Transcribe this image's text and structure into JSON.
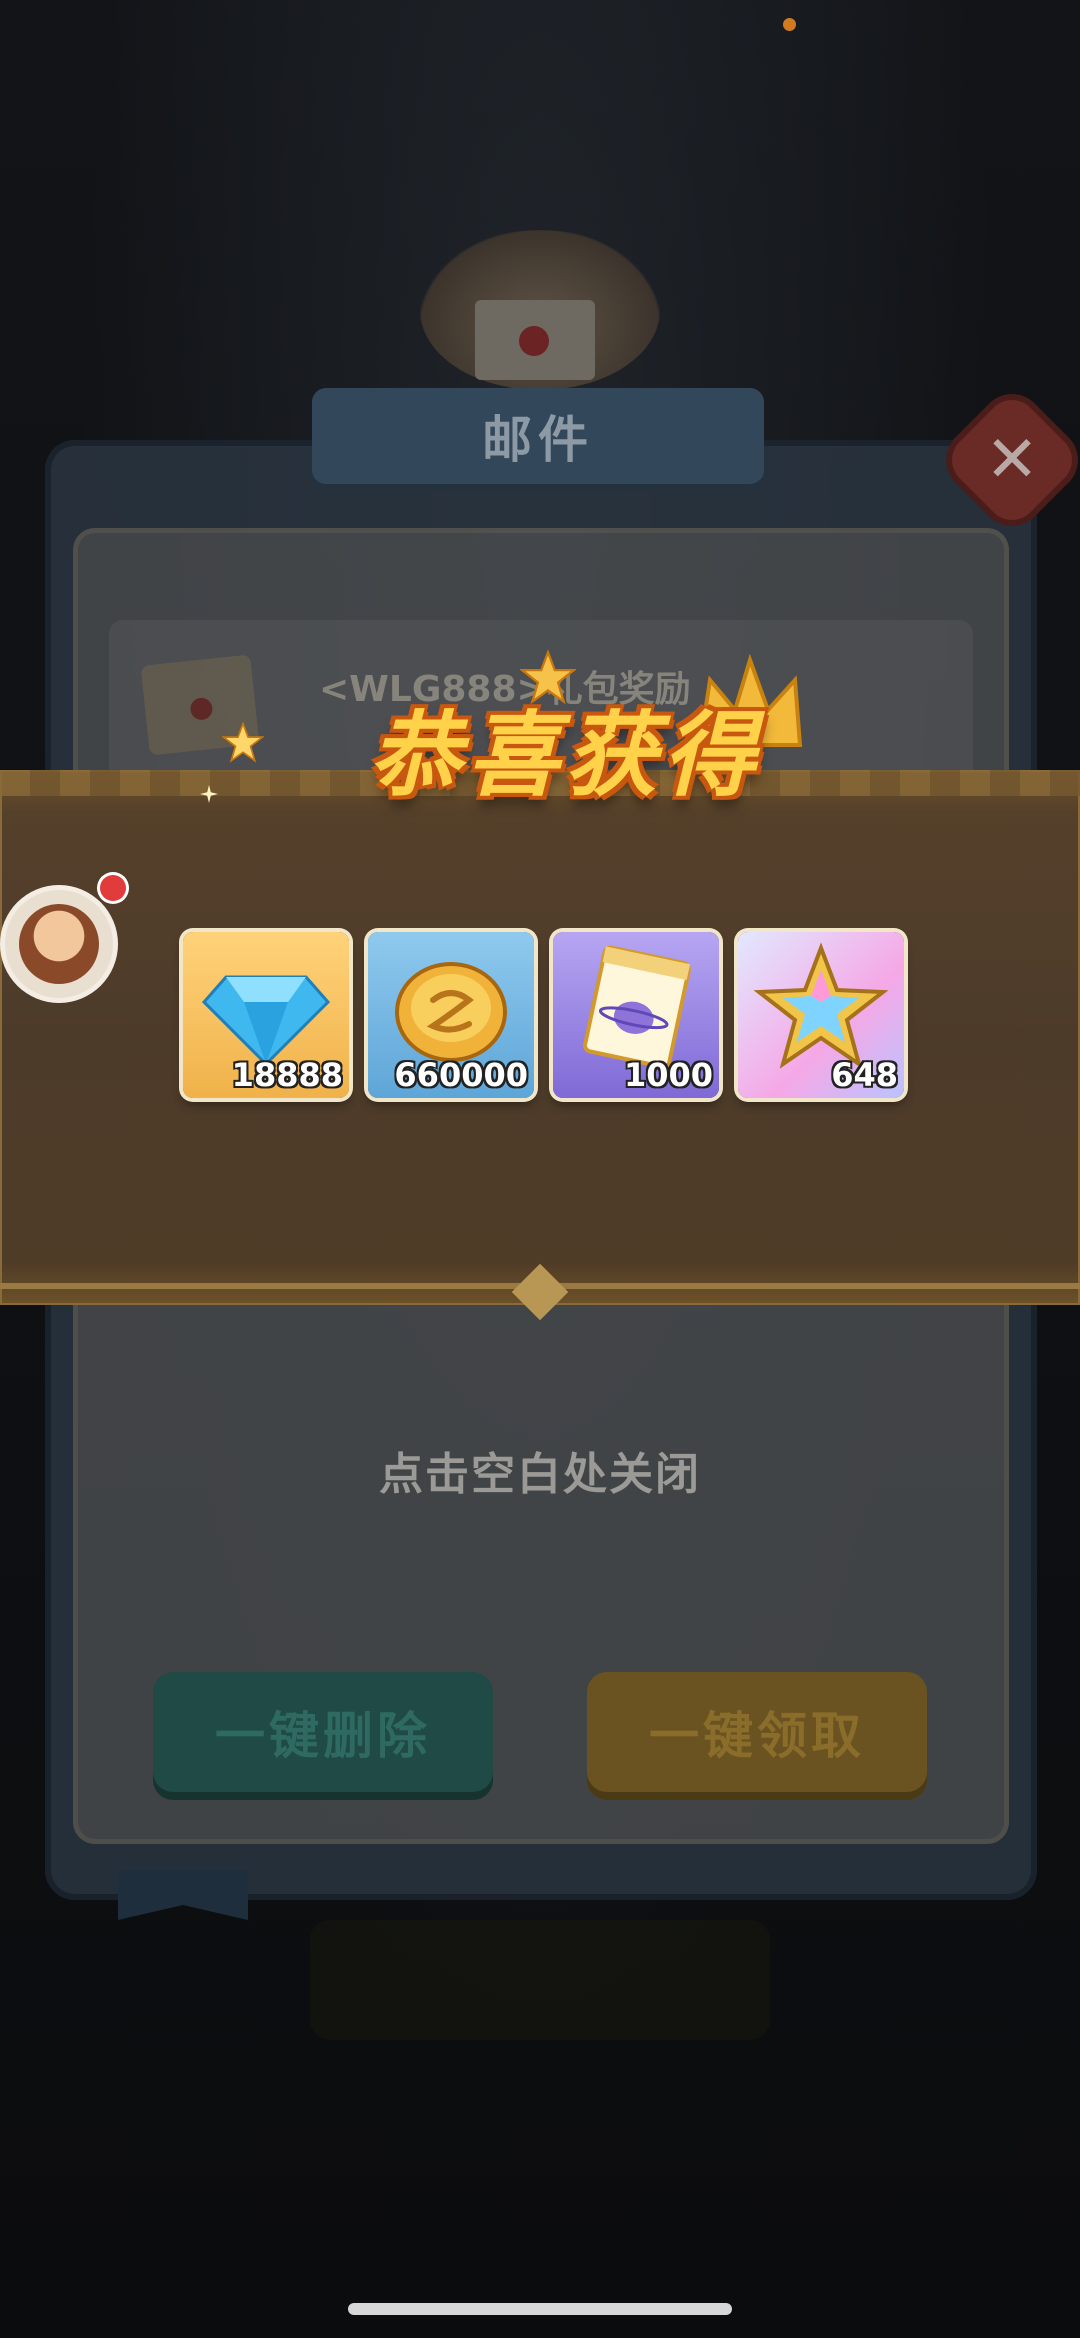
{
  "mail_dialog": {
    "title": "邮件",
    "close_symbol": "✕",
    "item_title": "<WLG888>礼包奖励",
    "hint": "点击空白处关闭",
    "delete_all_label": "一键删除",
    "claim_all_label": "一键领取"
  },
  "reward_popup": {
    "title": "恭喜获得",
    "items": [
      {
        "icon": "diamond-icon",
        "count": "18888"
      },
      {
        "icon": "gold-coin-icon",
        "count": "660000"
      },
      {
        "icon": "integral-ticket-icon",
        "count": "1000"
      },
      {
        "icon": "star-crystal-icon",
        "count": "648"
      }
    ]
  },
  "colors": {
    "title_fill": "#ffd24a",
    "title_outline": "#c8570f",
    "band": "#4d3b2a"
  }
}
